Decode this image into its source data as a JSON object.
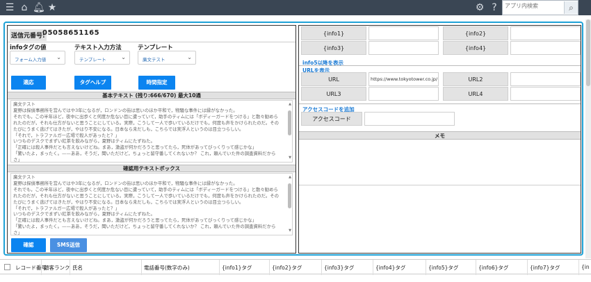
{
  "topbar": {
    "search_placeholder": "アプリ内検索"
  },
  "sender": {
    "label": "送信元番号:",
    "value": "05058651165"
  },
  "controls": {
    "info_tag_label": "infoタグの値",
    "info_tag_value": "フォーム入力値",
    "text_method_label": "テキスト入力方法",
    "text_method_value": "テンプレート",
    "template_label": "テンプレート",
    "template_value": "廣文テスト"
  },
  "buttons": {
    "apply": "適応",
    "tag_help": "タグヘルプ",
    "time_spec": "時間指定",
    "confirm": "確認",
    "sms_send": "SMS送信"
  },
  "basic_text": {
    "header": "基本テキスト (残り:666/670) 最大10通",
    "lines": [
      "廣文テスト",
      "夏野は探偵事務所を営んではや3年になるが，ロンドンの街は思いのほか平和で，物騒な事件には縁がなかった。",
      "それでも，この半年ほど，夜中に出歩くと何度か危ない目に遭っていて，助手のティムには「ボディーガードをつける」と散々勧められたのだが，それも仕方がないと思うことにしている。実際，こうして一人で歩いているだけでも，何度も声をかけられたのだ。そのたびにうまく逃げてはきたが，やはり不安になる。日本なら未だしも，こちらでは実浮人というのは目立つらしい。",
      "「それで，トラファルガー広場で殺人があったと？」",
      "いつものデスクでまずい紅茶を飲みながら，夏野はティムにたずねた。",
      "「正確には殺人事件だとも言えないけどね。まあ，激盗が何かだろうと思ってたら，死体があってびっくりって感じかな」",
      "「驚いたよ，まったく。——ああ，そうだ，聞いただけど，ちょっと留守番してくれないか？ これ，頼んでいた件の調査資料だからさ」"
    ]
  },
  "confirm_text": {
    "header": "確認用テキストボックス",
    "lines": [
      "廣文テスト",
      "夏野は探偵事務所を営んではや3年になるが，ロンドンの街は思いのほか平和で，物騒な事件には縁がなかった。",
      "それでも，この半年ほど，夜中に出歩くと何度か危ない目に遭っていて，助手のティムには「ボディーガードをつける」と散々勧められたのだが，それも仕方がないと思うことにしている。実際，こうして一人で歩いているだけでも，何度も声をかけられたのだ。そのたびにうまく逃げてはきたが，やはり不安になる。日本なら未だしも，こちらでは実浮人というのは目立つらしい。",
      "「それで，トラファルガー広場で殺人があったと？」",
      "いつものデスクでまずい紅茶を飲みながら，夏野はティムにたずねた。",
      "「正確には殺人事件だとも言えないけどね。まあ，激盗が何かだろうと思ってたら，死体があってびっくりって感じかな」",
      "「驚いたよ，まったく。——ああ，そうだ，聞いただけど，ちょっと留守番してくれないか？ これ，頼んでいた件の調査資料だからさ」"
    ]
  },
  "right": {
    "info1": "{info1}",
    "info2": "{info2}",
    "info3": "{info3}",
    "info4": "{info4}",
    "info5_link": "info5以降を表示",
    "url_link": "URLを表示",
    "url_label": "URL",
    "url_value": "https://www.tokyotower.co.jp/",
    "url2_label": "URL2",
    "url3_label": "URL3",
    "url4_label": "URL4",
    "access_link": "アクセスコードを追加",
    "access_label": "アクセスコード",
    "memo_header": "メモ"
  },
  "table": {
    "columns": [
      "レコード番号",
      "顧客ランク",
      "氏名",
      "電話番号(数字のみ)",
      "{info1}タグ",
      "{info2}タグ",
      "{info3}タグ",
      "{info4}タグ",
      "{info5}タグ",
      "{info6}タグ",
      "{info7}タグ",
      "{in"
    ]
  }
}
